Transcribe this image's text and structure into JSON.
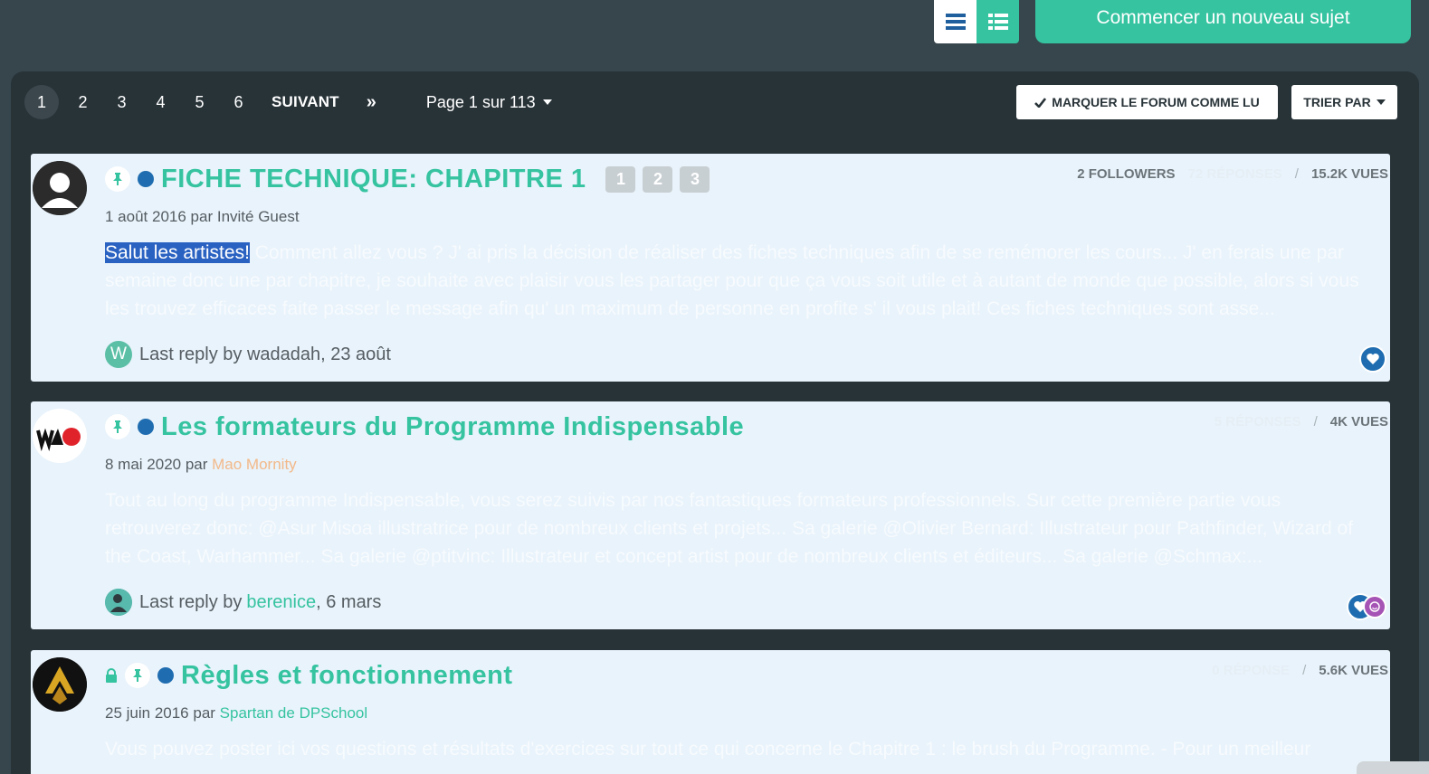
{
  "toolbar": {
    "view_list_icon": "list-icon",
    "view_grid_icon": "grid-list-icon",
    "new_topic_label": "Commencer un nouveau sujet"
  },
  "pagination": {
    "pages": [
      "1",
      "2",
      "3",
      "4",
      "5",
      "6"
    ],
    "active_page": "1",
    "next_label": "SUIVANT",
    "last_icon": "»",
    "page_status": "Page 1 sur 113"
  },
  "actions": {
    "mark_read_label": "MARQUER LE FORUM COMME LU",
    "sort_label": "TRIER PAR"
  },
  "topics": [
    {
      "title": "FICHE TECHNIQUE: CHAPITRE 1",
      "pinned": true,
      "locked": false,
      "mini_pages": [
        "1",
        "2",
        "3"
      ],
      "followers": "2 FOLLOWERS",
      "replies": "72 RÉPONSES",
      "views": "15.2K VUES",
      "date": "1 août 2016 par",
      "author": "Invité Guest",
      "excerpt_highlight": "Salut les artistes!",
      "excerpt": " Comment allez vous ? J' ai pris la décision de réaliser des fiches techniques afin de se remémorer les cours... J' en ferais une par semaine donc une par chapitre, je souhaite avec plaisir vous les partager pour que ça vous soit utile et à autant de monde que possible, alors si vous les trouvez efficaces faite passer le message afin qu' un maximum de personne en profite s' il vous plait! Ces fiches techniques sont asse...",
      "last_reply_prefix": "Last reply by wadadah, 23 août",
      "last_reply_avatar": "W"
    },
    {
      "title": "Les formateurs du Programme Indispensable",
      "pinned": true,
      "locked": false,
      "replies": "5 RÉPONSES",
      "views": "4K VUES",
      "date": "8 mai 2020 par",
      "author": "Mao Mornity",
      "excerpt": "Tout au long du programme Indispensable, vous serez suivis par nos fantastiques formateurs professionnels. Sur cette première partie vous retrouverez donc: @Asur Misoa illustratrice pour de nombreux clients et projets... Sa galerie @Olivier Bernard: Illustrateur pour Pathfinder, Wizard of the Coast, Warhammer... Sa galerie @ptitvinc: Illustrateur et concept artist pour de nombreux clients et éditeurs... Sa galerie @Schmax:...",
      "last_reply_prefix": "Last reply by",
      "last_reply_user": "berenice",
      "last_reply_date": ", 6 mars"
    },
    {
      "title": "Règles et fonctionnement",
      "pinned": true,
      "locked": true,
      "replies": "0 RÉPONSE",
      "views": "5.6K VUES",
      "date": "25 juin 2016 par",
      "author": "Spartan de DPSchool",
      "excerpt": "Vous pouvez poster ici vos questions et résultats d'exercices sur tout ce qui concerne le Chapitre 1 : le brush du Programme. - Pour un meilleur"
    }
  ],
  "colors": {
    "background": "#37464d",
    "panel": "#283338",
    "accent": "#35c3a0",
    "card": "#e9f3fb",
    "unread_dot": "#1f6db0"
  }
}
